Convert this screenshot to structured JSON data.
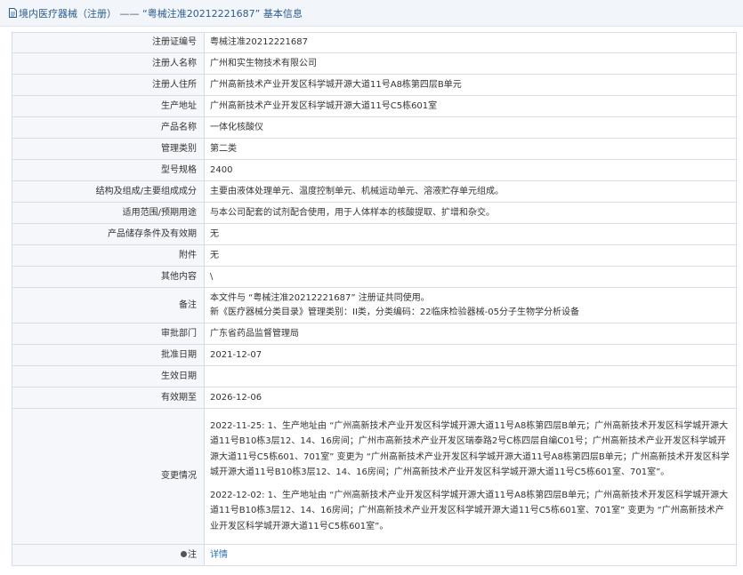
{
  "header": {
    "title": "境内医疗器械（注册） —— “粤械注准20212221687” 基本信息"
  },
  "rows": [
    {
      "label": "注册证编号",
      "value": "粤械注准20212221687"
    },
    {
      "label": "注册人名称",
      "value": "广州和实生物技术有限公司"
    },
    {
      "label": "注册人住所",
      "value": "广州高新技术产业开发区科学城开源大道11号A8栋第四层B单元"
    },
    {
      "label": "生产地址",
      "value": "广州高新技术产业开发区科学城开源大道11号C5栋601室"
    },
    {
      "label": "产品名称",
      "value": "一体化核酸仪"
    },
    {
      "label": "管理类别",
      "value": "第二类"
    },
    {
      "label": "型号规格",
      "value": "2400"
    },
    {
      "label": "结构及组成/主要组成成分",
      "value": "主要由液体处理单元、温度控制单元、机械运动单元、溶液贮存单元组成。"
    },
    {
      "label": "适用范围/预期用途",
      "value": "与本公司配套的试剂配合使用，用于人体样本的核酸提取、扩增和杂交。"
    },
    {
      "label": "产品储存条件及有效期",
      "value": "无"
    },
    {
      "label": "附件",
      "value": "无"
    },
    {
      "label": "其他内容",
      "value": "\\"
    }
  ],
  "remarks": {
    "label": "备注",
    "lines": [
      "本文件与 “粤械注准20212221687” 注册证共同使用。",
      "新《医疗器械分类目录》管理类别：II类，分类编码：22临床检验器械-05分子生物学分析设备"
    ]
  },
  "rows2": [
    {
      "label": "审批部门",
      "value": "广东省药品监督管理局"
    },
    {
      "label": "批准日期",
      "value": "2021-12-07"
    },
    {
      "label": "生效日期",
      "value": ""
    },
    {
      "label": "有效期至",
      "value": "2026-12-06"
    }
  ],
  "changes": {
    "label": "变更情况",
    "entries": [
      "2022-11-25: 1、生产地址由 “广州高新技术产业开发区科学城开源大道11号A8栋第四层B单元；广州高新技术开发区科学城开源大道11号B10栋3层12、14、16房间；广州市高新技术产业开发区瑞泰路2号C栋四层自编C01号；广州高新技术产业开发区科学城开源大道11号C5栋601、701室” 变更为 “广州高新技术产业开发区科学城开源大道11号A8栋第四层B单元；广州高新技术开发区科学城开源大道11号B10栋3层12、14、16房间；广州高新技术产业开发区科学城开源大道11号C5栋601室、701室”。",
      "2022-12-02: 1、生产地址由 “广州高新技术产业开发区科学城开源大道11号A8栋第四层B单元；广州高新技术开发区科学城开源大道11号B10栋3层12、14、16房间；广州高新技术产业开发区科学城开源大道11号C5栋601室、701室” 变更为 “广州高新技术产业开发区科学城开源大道11号C5栋601室”。"
    ]
  },
  "note": {
    "label": "注",
    "link": "详情"
  }
}
